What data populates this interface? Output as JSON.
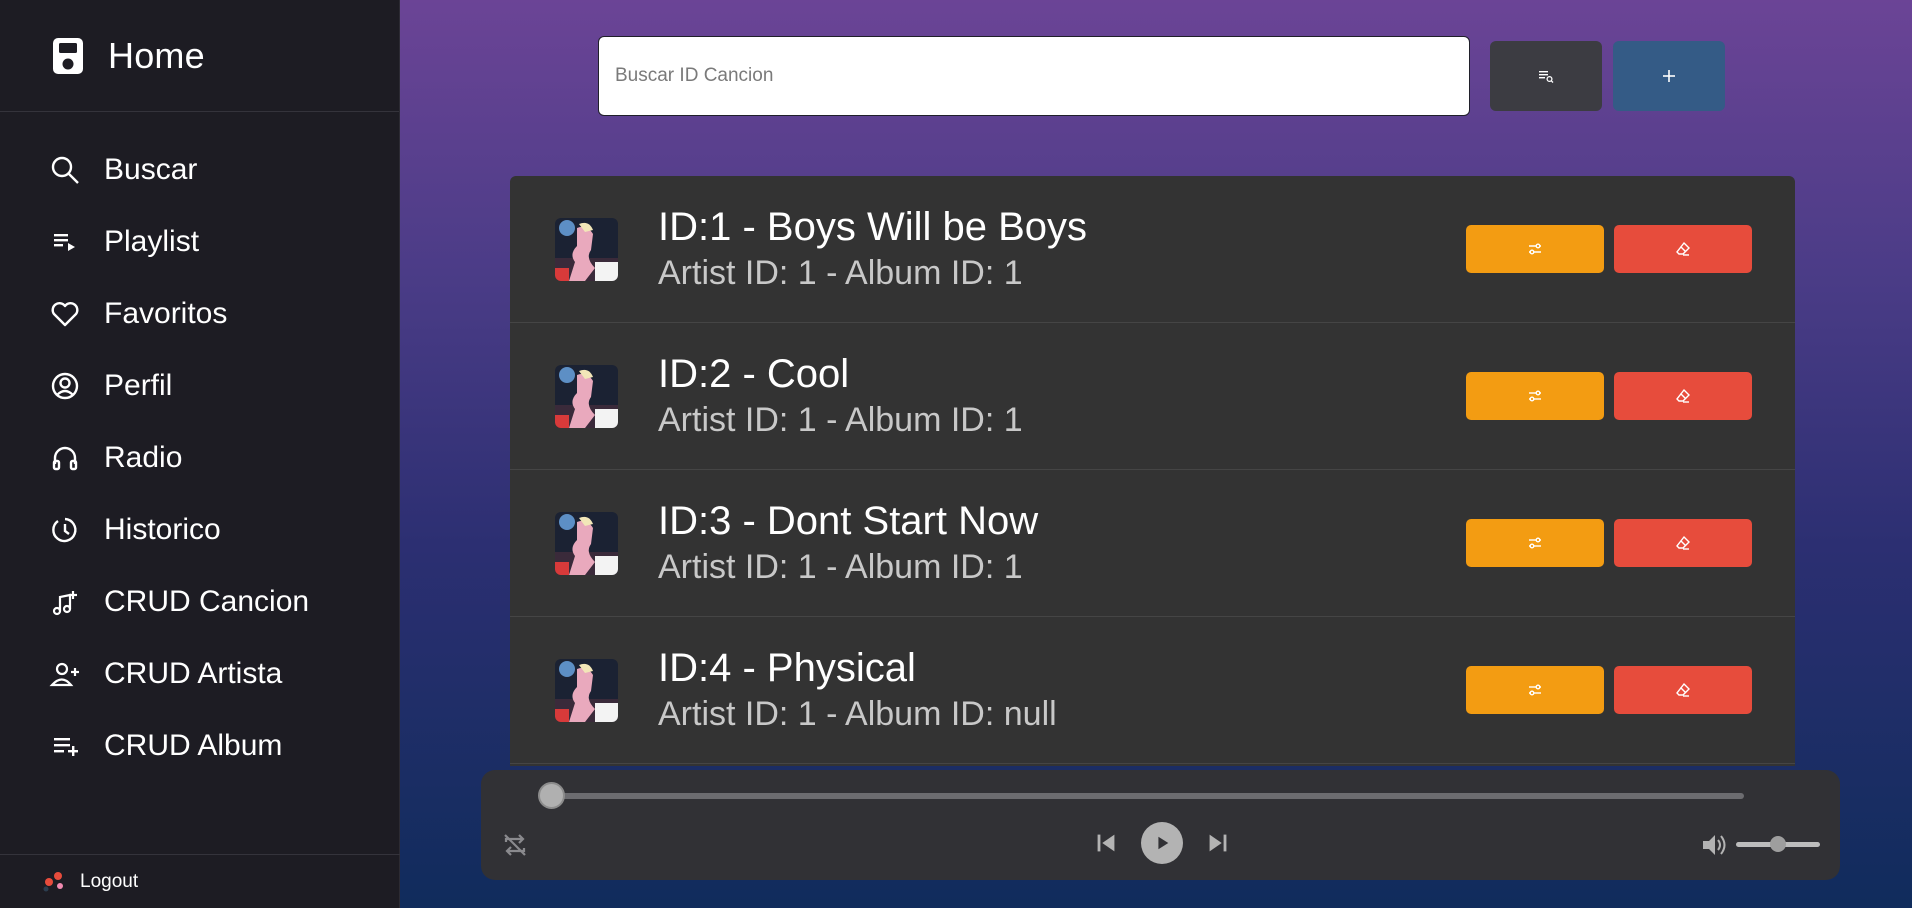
{
  "sidebar": {
    "brand": {
      "title": "Home",
      "icon": "ipod-icon"
    },
    "items": [
      {
        "label": "Buscar",
        "icon": "search-icon"
      },
      {
        "label": "Playlist",
        "icon": "playlist-icon"
      },
      {
        "label": "Favoritos",
        "icon": "heart-icon"
      },
      {
        "label": "Perfil",
        "icon": "user-circle-icon"
      },
      {
        "label": "Radio",
        "icon": "headphones-icon"
      },
      {
        "label": "Historico",
        "icon": "history-icon"
      },
      {
        "label": "CRUD Cancion",
        "icon": "music-plus-icon"
      },
      {
        "label": "CRUD Artista",
        "icon": "user-plus-icon"
      },
      {
        "label": "CRUD Album",
        "icon": "list-plus-icon"
      }
    ],
    "logout_label": "Logout"
  },
  "search": {
    "placeholder": "Buscar ID Cancion",
    "value": ""
  },
  "songs": [
    {
      "title": "ID:1 - Boys Will be Boys",
      "subtitle": "Artist ID: 1 - Album ID: 1"
    },
    {
      "title": "ID:2 - Cool",
      "subtitle": "Artist ID: 1 - Album ID: 1"
    },
    {
      "title": "ID:3 - Dont Start Now",
      "subtitle": "Artist ID: 1 - Album ID: 1"
    },
    {
      "title": "ID:4 - Physical",
      "subtitle": "Artist ID: 1 - Album ID: null"
    }
  ],
  "player": {
    "progress_fraction": 0.0,
    "volume_fraction": 0.5
  },
  "colors": {
    "edit_button": "#f39c12",
    "delete_button": "#e74c3c",
    "add_button": "#345b86",
    "search_button": "#3c3c42",
    "list_background": "#333333"
  }
}
